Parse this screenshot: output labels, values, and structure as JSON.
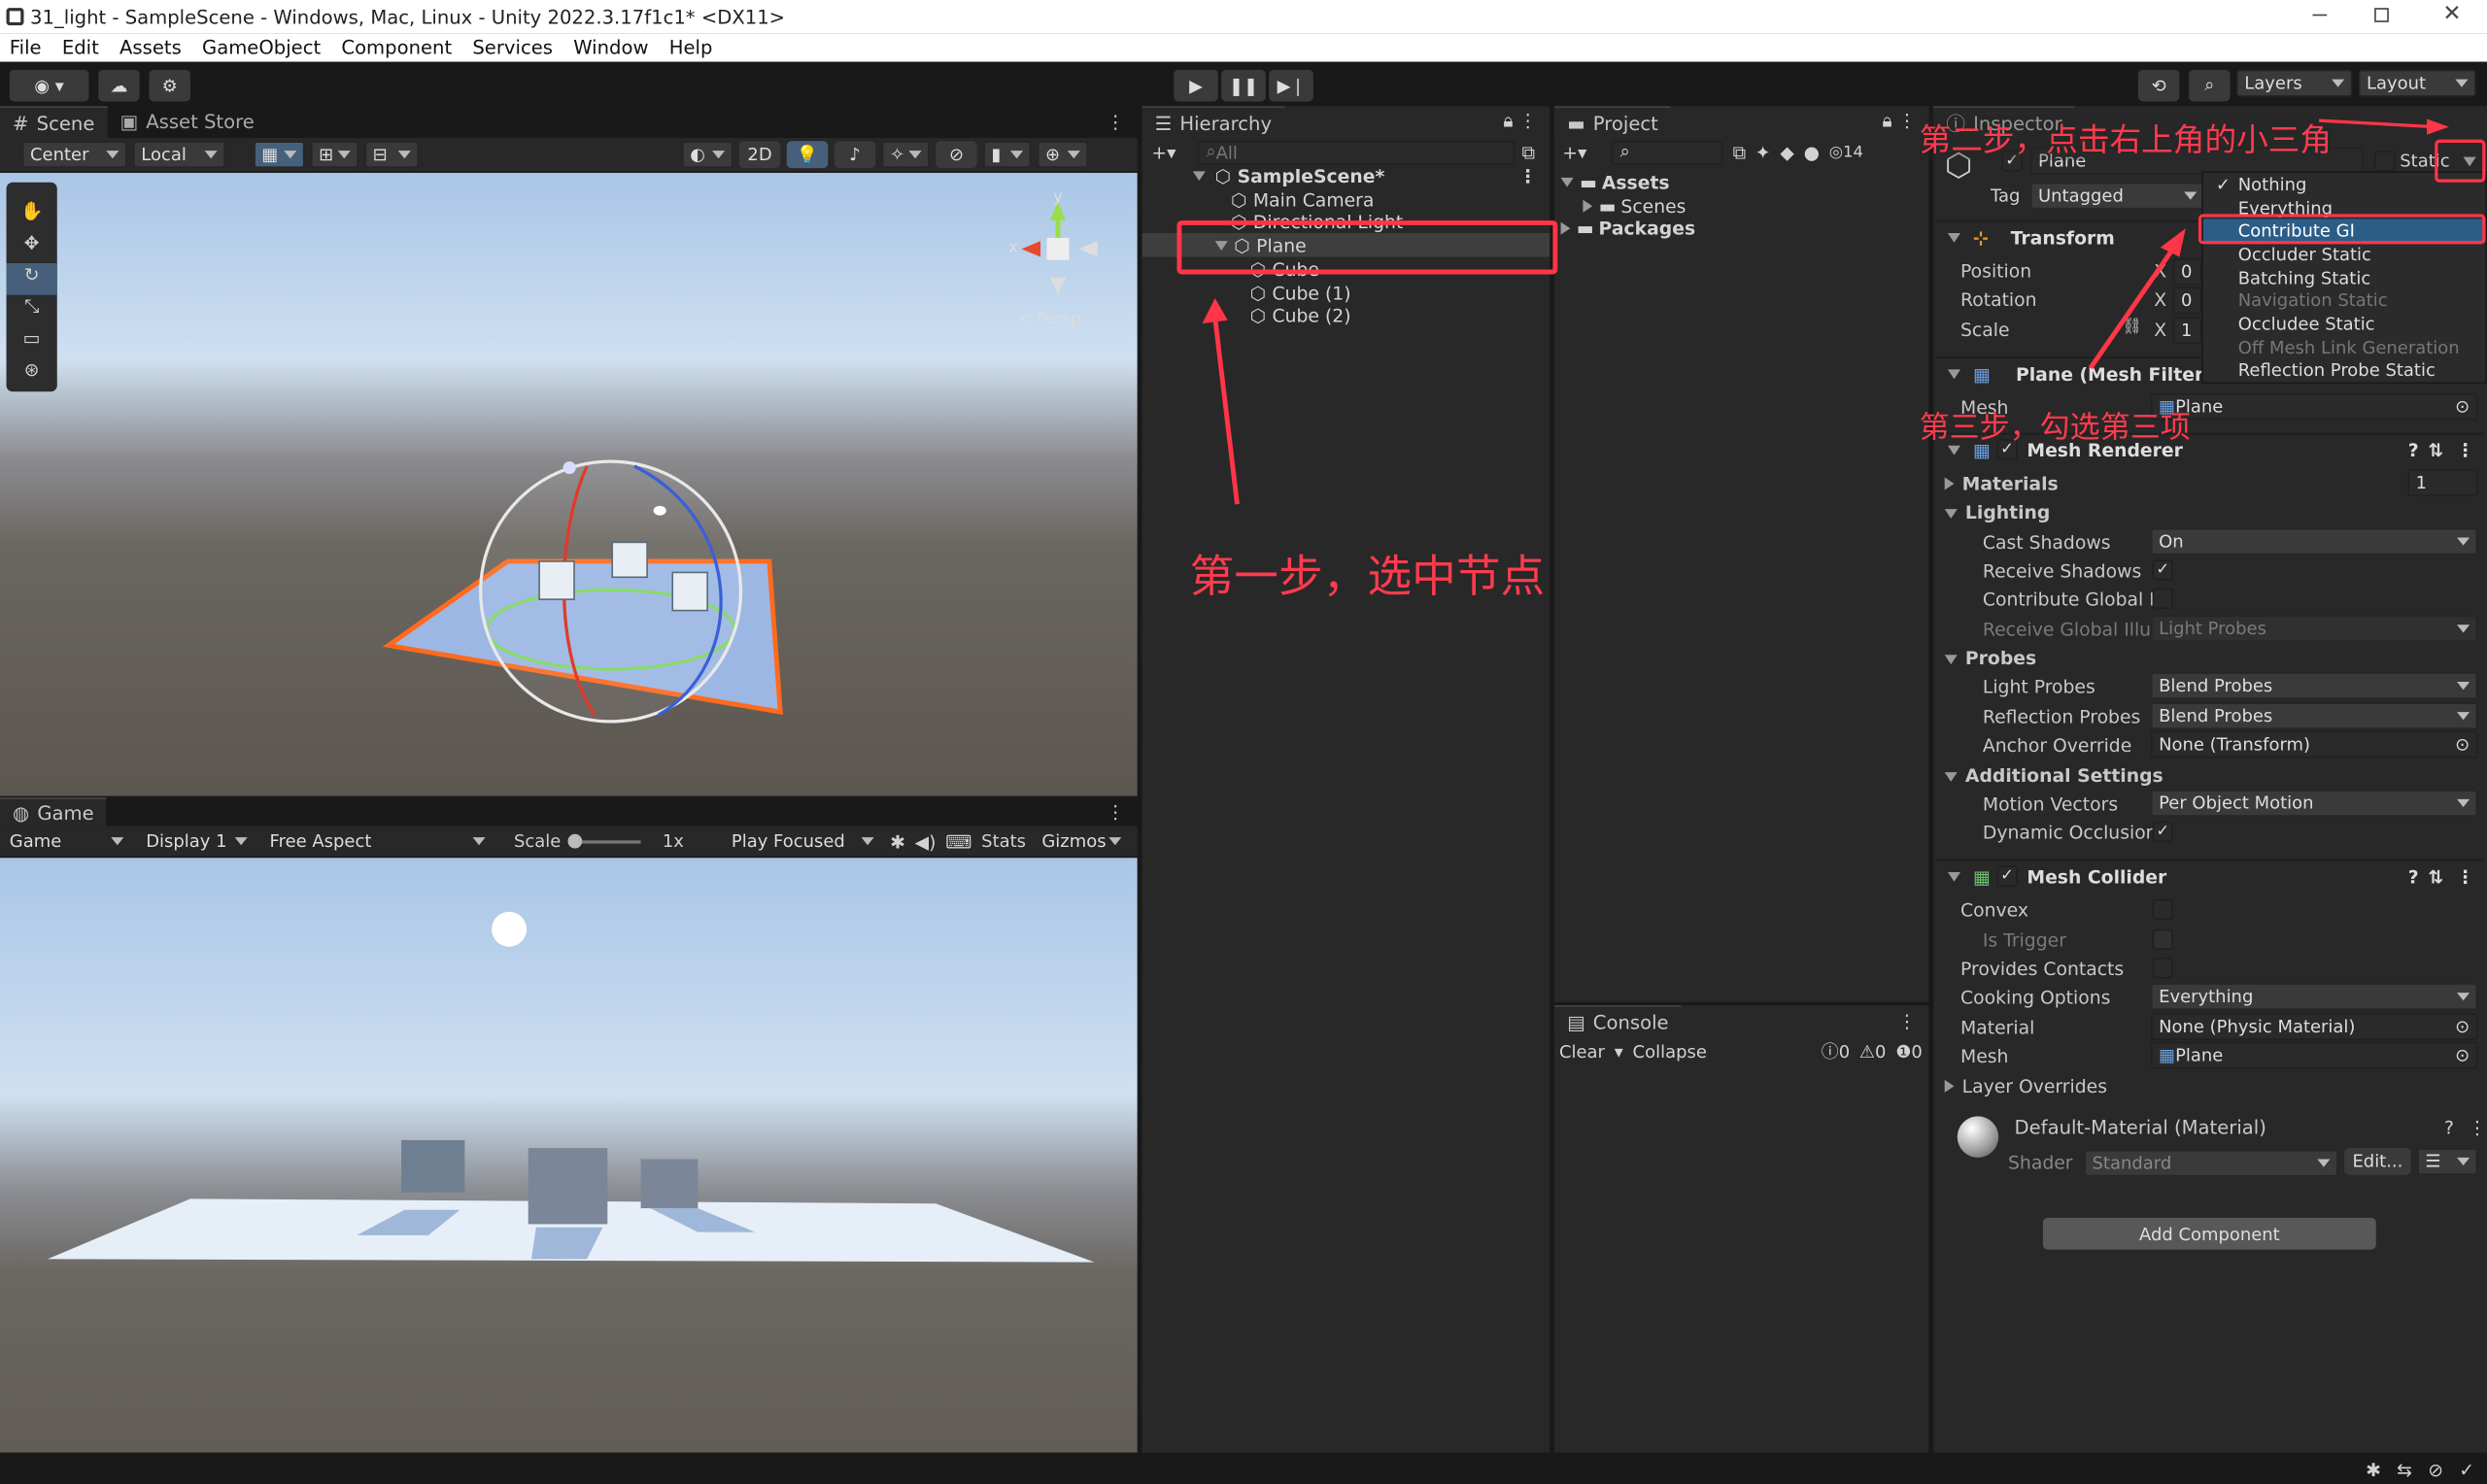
{
  "window": {
    "title": "31_light - SampleScene - Windows, Mac, Linux - Unity 2022.3.17f1c1* <DX11>"
  },
  "menu": [
    "File",
    "Edit",
    "Assets",
    "GameObject",
    "Component",
    "Services",
    "Window",
    "Help"
  ],
  "toolbar": {
    "layers": "Layers",
    "layout": "Layout"
  },
  "scene": {
    "tab_scene": "Scene",
    "tab_store": "Asset Store",
    "pivot": "Center",
    "space": "Local",
    "mode2d": "2D",
    "persp": "< Persp",
    "axis_x": "x",
    "axis_y": "y"
  },
  "game": {
    "tab": "Game",
    "display_mode": "Game",
    "display": "Display 1",
    "aspect": "Free Aspect",
    "scale_label": "Scale",
    "scale_value": "1x",
    "play_mode": "Play Focused",
    "stats": "Stats",
    "gizmos": "Gizmos"
  },
  "hierarchy": {
    "tab": "Hierarchy",
    "search_placeholder": "All",
    "scene": "SampleScene*",
    "items": [
      "Main Camera",
      "Directional Light",
      "Plane",
      "Cube",
      "Cube (1)",
      "Cube (2)"
    ]
  },
  "project": {
    "tab": "Project",
    "hidden_count": "14",
    "tree": [
      "Assets",
      "Scenes",
      "Packages"
    ]
  },
  "console": {
    "tab": "Console",
    "clear": "Clear",
    "collapse": "Collapse",
    "errors": "0",
    "warnings": "0",
    "logs": "0"
  },
  "inspector": {
    "tab": "Inspector",
    "name": "Plane",
    "tag_label": "Tag",
    "tag": "Untagged",
    "static_label": "Static",
    "static_menu": [
      "Nothing",
      "Everything",
      "Contribute GI",
      "Occluder Static",
      "Batching Static",
      "Navigation Static",
      "Occludee Static",
      "Off Mesh Link Generation",
      "Reflection Probe Static"
    ],
    "transform": {
      "title": "Transform",
      "position": "Position",
      "rotation": "Rotation",
      "scale": "Scale",
      "x": "X",
      "pos_x": "0",
      "rot_x": "0",
      "scale_x": "1"
    },
    "mesh_filter": {
      "title": "Plane (Mesh Filter)",
      "mesh_label": "Mesh",
      "mesh": "Plane"
    },
    "mesh_renderer": {
      "title": "Mesh Renderer",
      "materials": "Materials",
      "materials_count": "1",
      "lighting": "Lighting",
      "cast_shadows": "Cast Shadows",
      "cast_shadows_value": "On",
      "receive_shadows": "Receive Shadows",
      "contribute_gi": "Contribute Global Ill",
      "receive_gi": "Receive Global Illur",
      "receive_gi_value": "Light Probes",
      "probes": "Probes",
      "light_probes": "Light Probes",
      "light_probes_value": "Blend Probes",
      "reflection_probes": "Reflection Probes",
      "reflection_probes_value": "Blend Probes",
      "anchor_override": "Anchor Override",
      "anchor_override_value": "None (Transform)",
      "additional": "Additional Settings",
      "motion_vectors": "Motion Vectors",
      "motion_vectors_value": "Per Object Motion",
      "dynamic_occlusion": "Dynamic Occlusion"
    },
    "mesh_collider": {
      "title": "Mesh Collider",
      "convex": "Convex",
      "is_trigger": "Is Trigger",
      "provides_contacts": "Provides Contacts",
      "cooking": "Cooking Options",
      "cooking_value": "Everything",
      "material": "Material",
      "material_value": "None (Physic Material)",
      "mesh": "Mesh",
      "mesh_value": "Plane",
      "layer_overrides": "Layer Overrides"
    },
    "material": {
      "title": "Default-Material (Material)",
      "shader_label": "Shader",
      "shader": "Standard",
      "edit": "Edit..."
    },
    "add_component": "Add Component"
  },
  "annotations": {
    "step1": "第一步，选中节点",
    "step2": "第二步，点击右上角的小三角",
    "step3": "第三步，勾选第三项"
  },
  "colors": {
    "accent": "#ff3548",
    "selection": "#2c5d87",
    "panel": "#282828"
  }
}
